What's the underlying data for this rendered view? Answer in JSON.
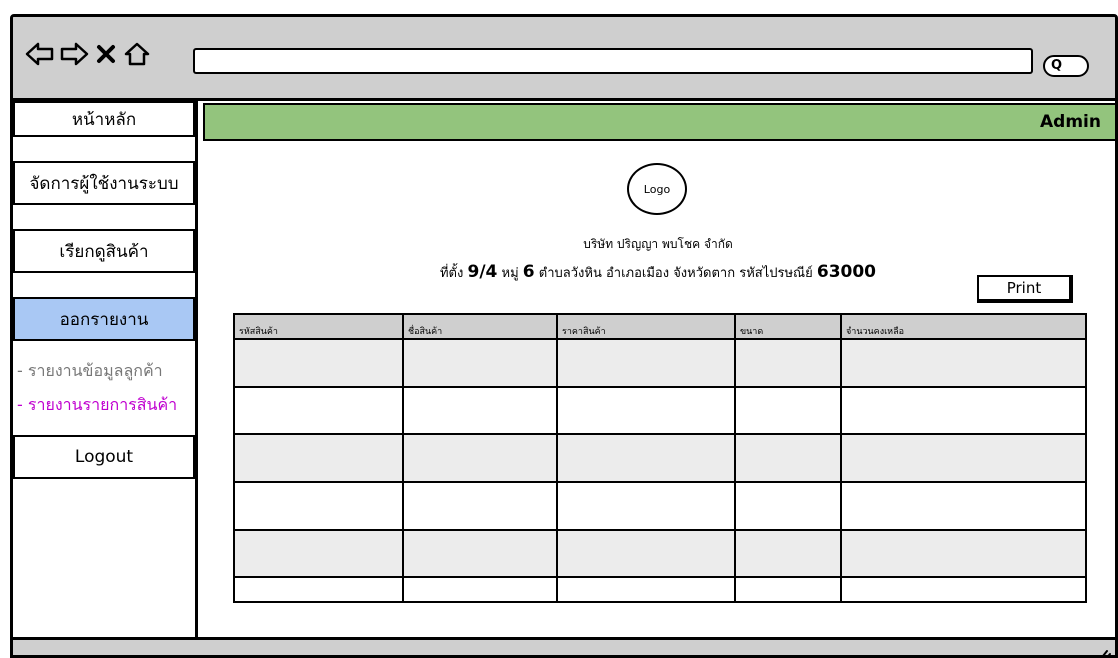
{
  "browser": {
    "nav_icons": [
      "back-arrow-icon",
      "forward-arrow-icon",
      "close-icon",
      "home-icon"
    ],
    "url": "",
    "search_icon_label": "Q"
  },
  "sidebar": {
    "items": [
      {
        "label": "หน้าหลัก"
      },
      {
        "label": "จัดการผู้ใช้งานระบบ"
      },
      {
        "label": "เรียกดูสินค้า"
      },
      {
        "label": "ออกรายงาน",
        "active": true
      }
    ],
    "sub_links": [
      {
        "label": "- รายงานข้อมูลลูกค้า",
        "color": "#777777"
      },
      {
        "label": "- รายงานรายการสินค้า",
        "color": "#c000d0"
      }
    ],
    "logout_label": "Logout"
  },
  "header": {
    "user": "Admin",
    "color": "#93c47d"
  },
  "report": {
    "logo_label": "Logo",
    "company": "บริษัท ปริญญา พบโชค จำกัด",
    "address_prefix": "ที่ตั้ง",
    "house_no": "9/4",
    "moo_label": "หมู่",
    "moo": "6",
    "address_rest": "ตำบลวังหิน อำเภอเมือง จังหวัดตาก รหัสไปรษณีย์",
    "postcode": "63000",
    "print_label": "Print"
  },
  "table": {
    "headers": [
      "รหัสสินค้า",
      "ชื่อสินค้า",
      "ราคาสินค้า",
      "ขนาด",
      "จำนวนคงเหลือ"
    ],
    "rows": [
      [
        "",
        "",
        "",
        "",
        ""
      ],
      [
        "",
        "",
        "",
        "",
        ""
      ],
      [
        "",
        "",
        "",
        "",
        ""
      ],
      [
        "",
        "",
        "",
        "",
        ""
      ],
      [
        "",
        "",
        "",
        "",
        ""
      ],
      [
        "",
        "",
        "",
        "",
        ""
      ]
    ]
  }
}
